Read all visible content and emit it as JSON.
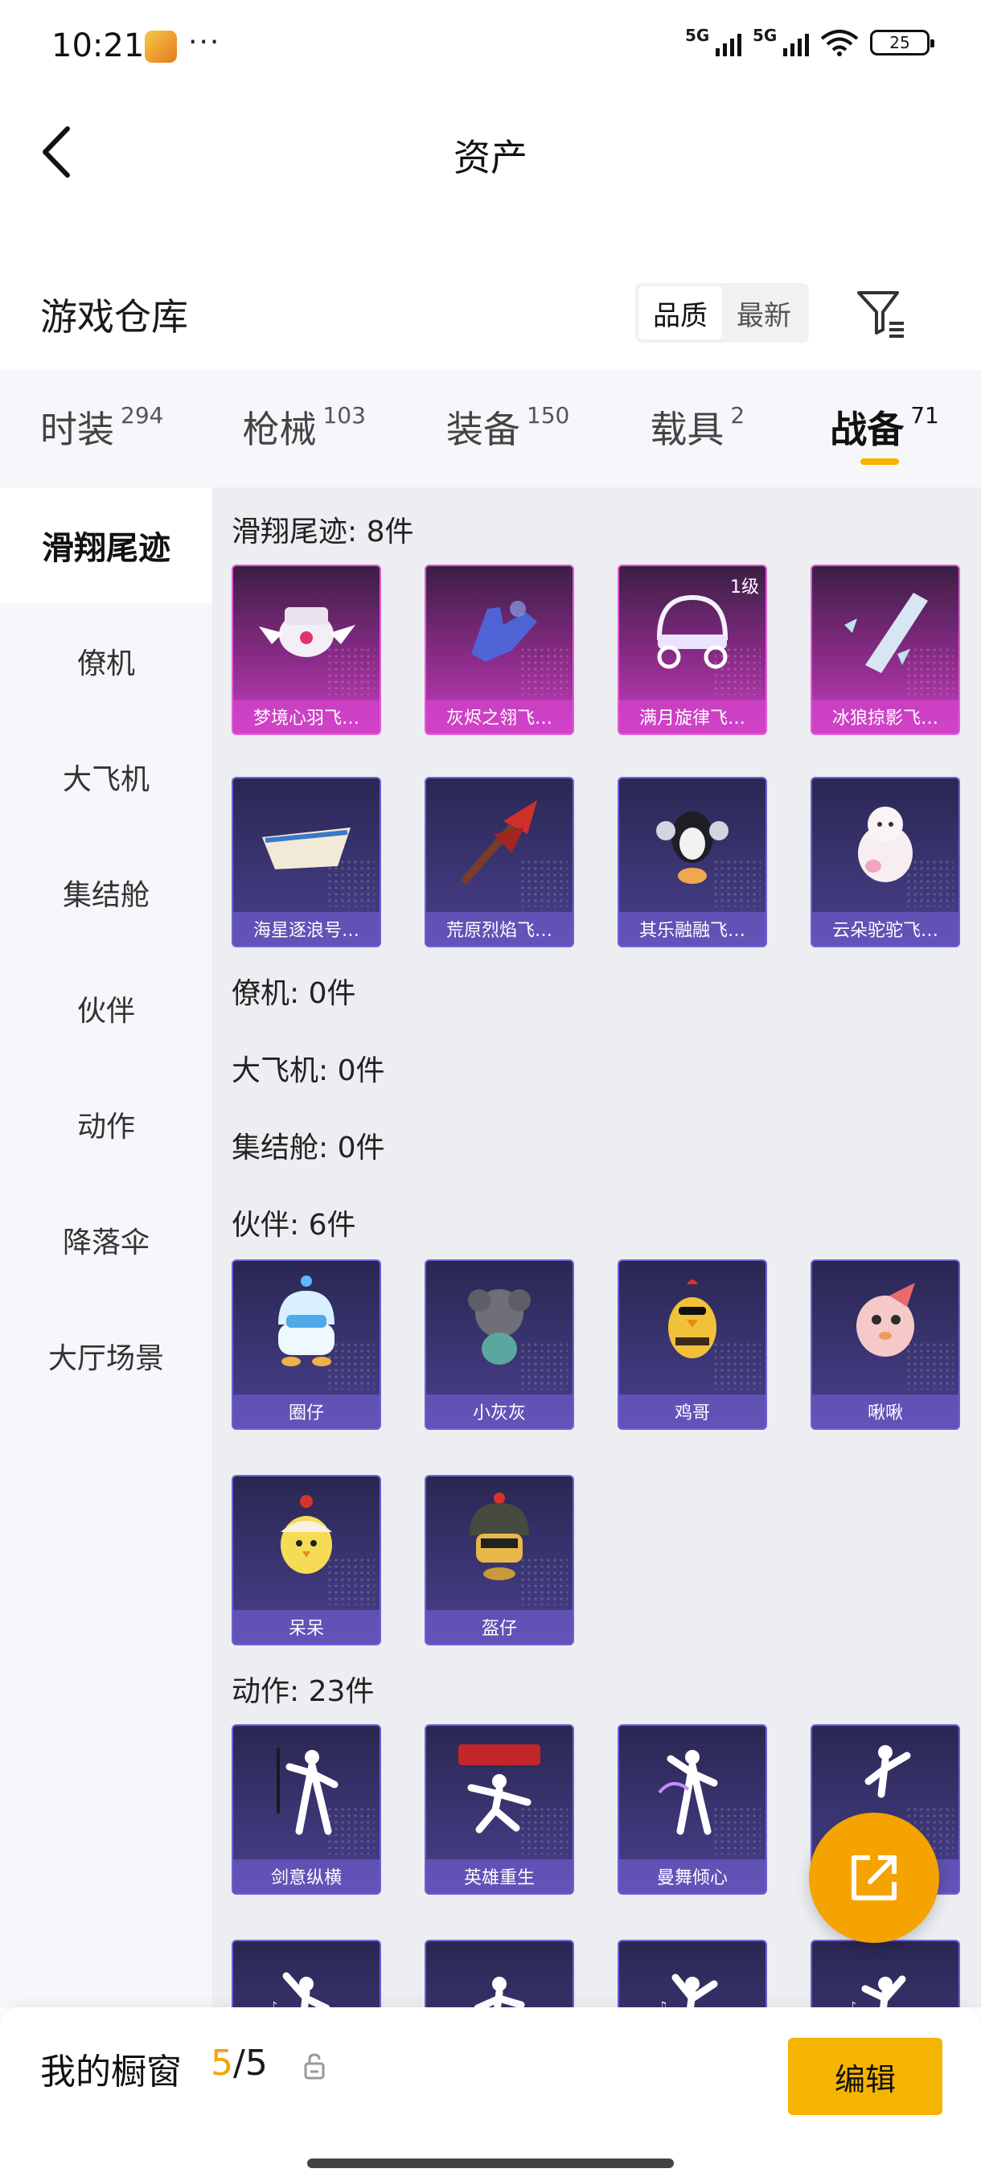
{
  "status_bar": {
    "time": "10:21",
    "dots": "···",
    "net1": "5G",
    "net2": "5G",
    "battery": "25"
  },
  "header": {
    "title": "资产"
  },
  "warehouse": {
    "title": "游戏仓库",
    "sort_options": [
      "品质",
      "最新"
    ],
    "active_sort": 0
  },
  "tabs": [
    {
      "label": "时装",
      "count": "294"
    },
    {
      "label": "枪械",
      "count": "103"
    },
    {
      "label": "装备",
      "count": "150"
    },
    {
      "label": "载具",
      "count": "2"
    },
    {
      "label": "战备",
      "count": "71",
      "active": true
    }
  ],
  "sidebar": [
    "滑翔尾迹",
    "僚机",
    "大飞机",
    "集结舱",
    "伙伴",
    "动作",
    "降落伞",
    "大厅场景"
  ],
  "sections": [
    {
      "title": "滑翔尾迹: 8件",
      "items": [
        {
          "label": "梦境心羽飞…",
          "style": "pink"
        },
        {
          "label": "灰烬之翎飞…",
          "style": "pink"
        },
        {
          "label": "满月旋律飞…",
          "style": "pink",
          "badge": "1级"
        },
        {
          "label": "冰狼掠影飞…",
          "style": "pink"
        },
        {
          "label": "海星逐浪号…",
          "style": "purple"
        },
        {
          "label": "荒原烈焰飞…",
          "style": "purple"
        },
        {
          "label": "其乐融融飞…",
          "style": "purple"
        },
        {
          "label": "云朵驼驼飞…",
          "style": "purple"
        }
      ]
    },
    {
      "title": "僚机: 0件",
      "items": []
    },
    {
      "title": "大飞机: 0件",
      "items": []
    },
    {
      "title": "集结舱: 0件",
      "items": []
    },
    {
      "title": "伙伴: 6件",
      "items": [
        {
          "label": "圈仔",
          "style": "purple"
        },
        {
          "label": "小灰灰",
          "style": "purple"
        },
        {
          "label": "鸡哥",
          "style": "purple"
        },
        {
          "label": "啾啾",
          "style": "purple"
        },
        {
          "label": "呆呆",
          "style": "purple"
        },
        {
          "label": "盔仔",
          "style": "purple"
        }
      ]
    },
    {
      "title": "动作: 23件",
      "items": [
        {
          "label": "剑意纵横",
          "style": "purple"
        },
        {
          "label": "英雄重生",
          "style": "purple"
        },
        {
          "label": "曼舞倾心",
          "style": "purple"
        },
        {
          "label": "",
          "style": "purple"
        },
        {
          "label": "",
          "style": "purple"
        },
        {
          "label": "",
          "style": "purple"
        },
        {
          "label": "",
          "style": "purple"
        },
        {
          "label": "",
          "style": "purple"
        }
      ]
    }
  ],
  "bottom_bar": {
    "title": "我的橱窗",
    "count_current": "5",
    "count_total": "/5",
    "edit_label": "编辑"
  },
  "colors": {
    "accent": "#f5b400",
    "rarity_pink": "#e25bd8",
    "rarity_purple": "#6d61d6"
  }
}
